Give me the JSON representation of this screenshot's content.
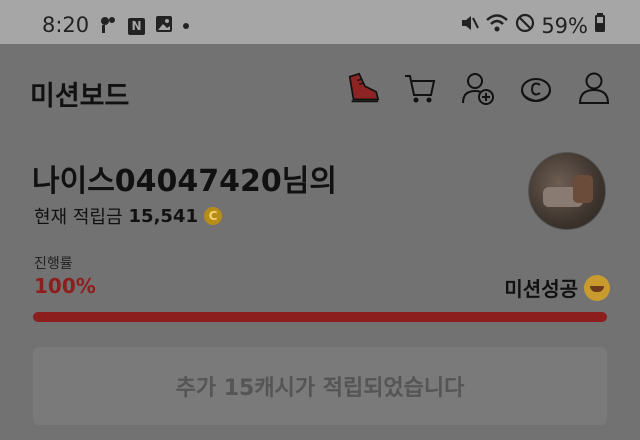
{
  "status_bar": {
    "time": "8:20",
    "battery": "59%",
    "left_icons": [
      "pinwheel-icon",
      "n-badge-icon",
      "image-icon",
      "dot-icon"
    ],
    "n_badge": "N",
    "right_icons": [
      "mute-icon",
      "wifi-icon",
      "dnd-icon",
      "battery-icon"
    ]
  },
  "header": {
    "title": "미션보드",
    "icons": [
      "sneaker-icon",
      "cart-icon",
      "add-friend-icon",
      "cash-icon",
      "profile-icon"
    ]
  },
  "user": {
    "greeting": "나이스04047420님의",
    "points_label": "현재 적립금",
    "points_value": "15,541",
    "coin_letter": "C"
  },
  "progress": {
    "label": "진행률",
    "percent_text": "100%",
    "value": 1.0,
    "status": "미션성공",
    "color": "#8c1e1e"
  },
  "cta": {
    "label": "추가 15캐시가 적립되었습니다"
  }
}
